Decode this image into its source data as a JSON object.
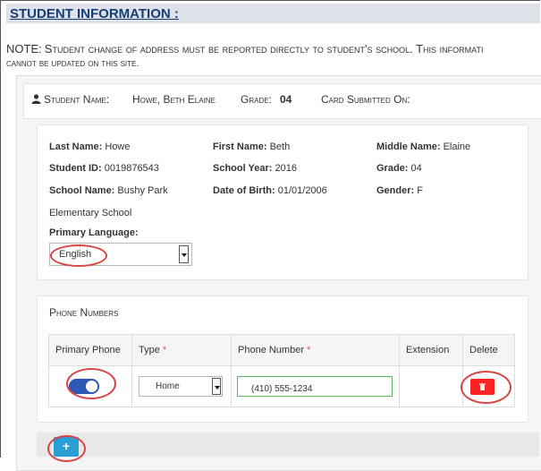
{
  "header": {
    "title": "STUDENT INFORMATION :"
  },
  "note": {
    "lead_label": "NOTE:",
    "line1_rest": "Student change of address must be reported directly to student's school. This informati",
    "line2": "cannot be updated on this site."
  },
  "summary": {
    "student_name_label": "Student Name:",
    "student_name_value": "Howe, Beth Elaine",
    "grade_label": "Grade:",
    "grade_value": "04",
    "card_submitted_label": "Card Submitted On:"
  },
  "details": {
    "last_name_label": "Last Name:",
    "last_name_value": "Howe",
    "first_name_label": "First Name:",
    "first_name_value": "Beth",
    "middle_name_label": "Middle Name:",
    "middle_name_value": "Elaine",
    "student_id_label": "Student ID:",
    "student_id_value": "0019876543",
    "school_year_label": "School Year:",
    "school_year_value": "2016",
    "grade_label": "Grade:",
    "grade_value": "04",
    "school_name_label": "School Name:",
    "school_name_value_line1": "Bushy Park",
    "school_name_value_line2": "Elementary School",
    "dob_label": "Date of Birth:",
    "dob_value": "01/01/2006",
    "gender_label": "Gender:",
    "gender_value": "F",
    "primary_language_label": "Primary Language:",
    "primary_language_value": "English"
  },
  "phones": {
    "title": "Phone Numbers",
    "columns": {
      "primary_phone": "Primary Phone",
      "type": "Type",
      "phone_number": "Phone Number",
      "extension": "Extension",
      "delete": "Delete",
      "required_marker": "*"
    },
    "rows": [
      {
        "primary": true,
        "type": "Home",
        "phone_number": "(410) 555-1234",
        "extension": ""
      }
    ]
  },
  "add_button_label": "+",
  "colors": {
    "header_text": "#173e72",
    "header_bg": "#dde2ea",
    "toggle_on": "#2f58b5",
    "delete_button": "#ff2222",
    "add_button": "#2a9fd6",
    "annotation_ring": "#d94545",
    "required_marker": "#d9534f",
    "input_border_valid": "#5cb85c"
  },
  "icons": {
    "user": "user-icon",
    "trash": "trash-icon",
    "toggle": "toggle-switch",
    "dropdown": "chevron-down-icon"
  }
}
